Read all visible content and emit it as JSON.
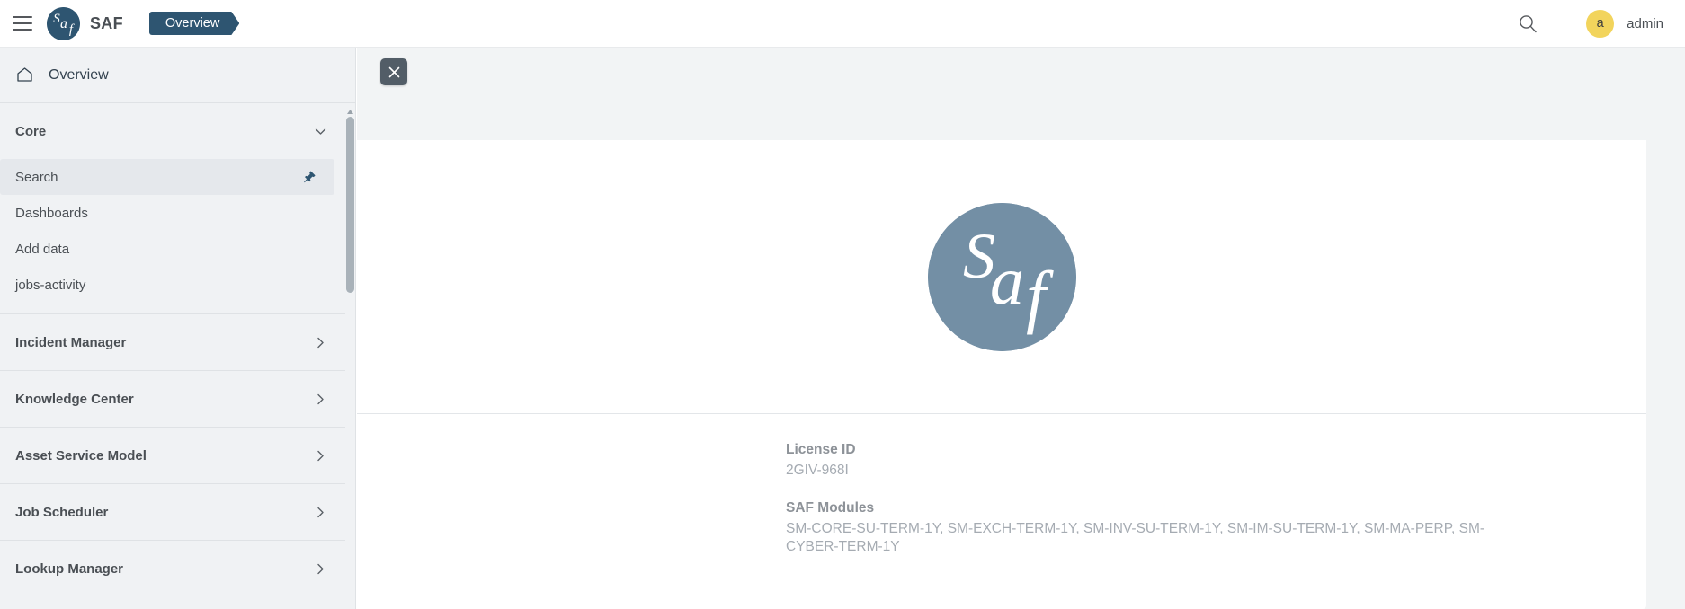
{
  "header": {
    "menu_icon": "hamburger-icon",
    "brand_logo_text": "Saf",
    "brand_name": "SAF",
    "active_tab": "Overview",
    "search_icon": "search-icon",
    "avatar_initial": "a",
    "username": "admin"
  },
  "sidebar": {
    "overview": {
      "icon": "home-icon",
      "label": "Overview"
    },
    "sections": [
      {
        "title": "Core",
        "expanded": true,
        "chevron": "chevron-down-icon",
        "items": [
          {
            "label": "Search",
            "active": true,
            "pin_icon": "pin-icon"
          },
          {
            "label": "Dashboards",
            "active": false
          },
          {
            "label": "Add data",
            "active": false
          },
          {
            "label": "jobs-activity",
            "active": false
          }
        ]
      },
      {
        "title": "Incident Manager",
        "expanded": false,
        "chevron": "chevron-right-icon",
        "items": []
      },
      {
        "title": "Knowledge Center",
        "expanded": false,
        "chevron": "chevron-right-icon",
        "items": []
      },
      {
        "title": "Asset Service Model",
        "expanded": false,
        "chevron": "chevron-right-icon",
        "items": []
      },
      {
        "title": "Job Scheduler",
        "expanded": false,
        "chevron": "chevron-right-icon",
        "items": []
      },
      {
        "title": "Lookup Manager",
        "expanded": false,
        "chevron": "chevron-right-icon",
        "items": []
      }
    ]
  },
  "main": {
    "close_button_icon": "close-icon",
    "logo_text": "Saf",
    "license": {
      "label": "License ID",
      "value": "2GIV-968I"
    },
    "modules": {
      "label": "SAF Modules",
      "value": "SM-CORE-SU-TERM-1Y, SM-EXCH-TERM-1Y, SM-INV-SU-TERM-1Y, SM-IM-SU-TERM-1Y, SM-MA-PERP, SM-CYBER-TERM-1Y"
    }
  },
  "colors": {
    "brand_dark": "#2e5571",
    "logo_blue": "#738fa5",
    "avatar_yellow": "#f2d45c",
    "sidebar_bg": "#f0f2f4",
    "main_bg": "#f2f4f5",
    "close_btn": "#525d67"
  }
}
